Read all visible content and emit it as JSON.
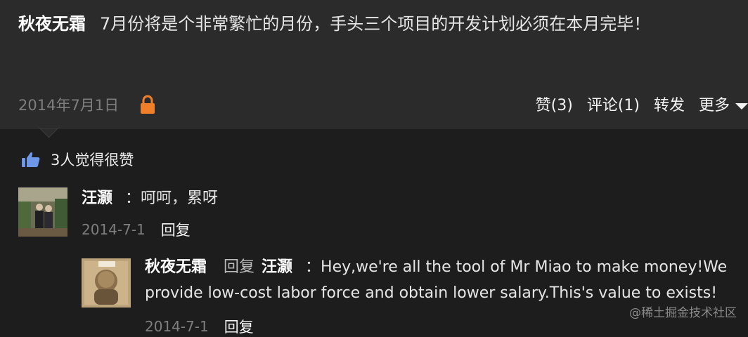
{
  "post": {
    "author": "秋夜无霜",
    "text": "7月份将是个非常繁忙的月份，手头三个项目的开发计划必须在本月完毕！",
    "date": "2014年7月1日",
    "actions": {
      "like": "赞(3)",
      "comment": "评论(1)",
      "share": "转发",
      "more": "更多"
    }
  },
  "likes": {
    "summary": "3人觉得很赞"
  },
  "comments": [
    {
      "author": "汪灏",
      "text": "：呵呵，累呀",
      "date": "2014-7-1",
      "reply_label": "回复"
    },
    {
      "author": "秋夜无霜",
      "reply_word": "回复",
      "reply_to": "汪灏",
      "text": "：Hey,we're all the tool of Mr Miao to make money!We provide low-cost labor force and obtain lower salary.This's value to exists!",
      "date": "2014-7-1",
      "reply_label": "回复"
    }
  ],
  "watermark": "@稀土掘金技术社区",
  "icons": {
    "lock": "lock-icon",
    "like": "thumbs-up-icon",
    "more": "caret-down-icon"
  },
  "colors": {
    "background": "#1d1d1d",
    "post_background": "#2b2b2b",
    "lock": "#f07f2a",
    "like": "#6f97e8"
  }
}
